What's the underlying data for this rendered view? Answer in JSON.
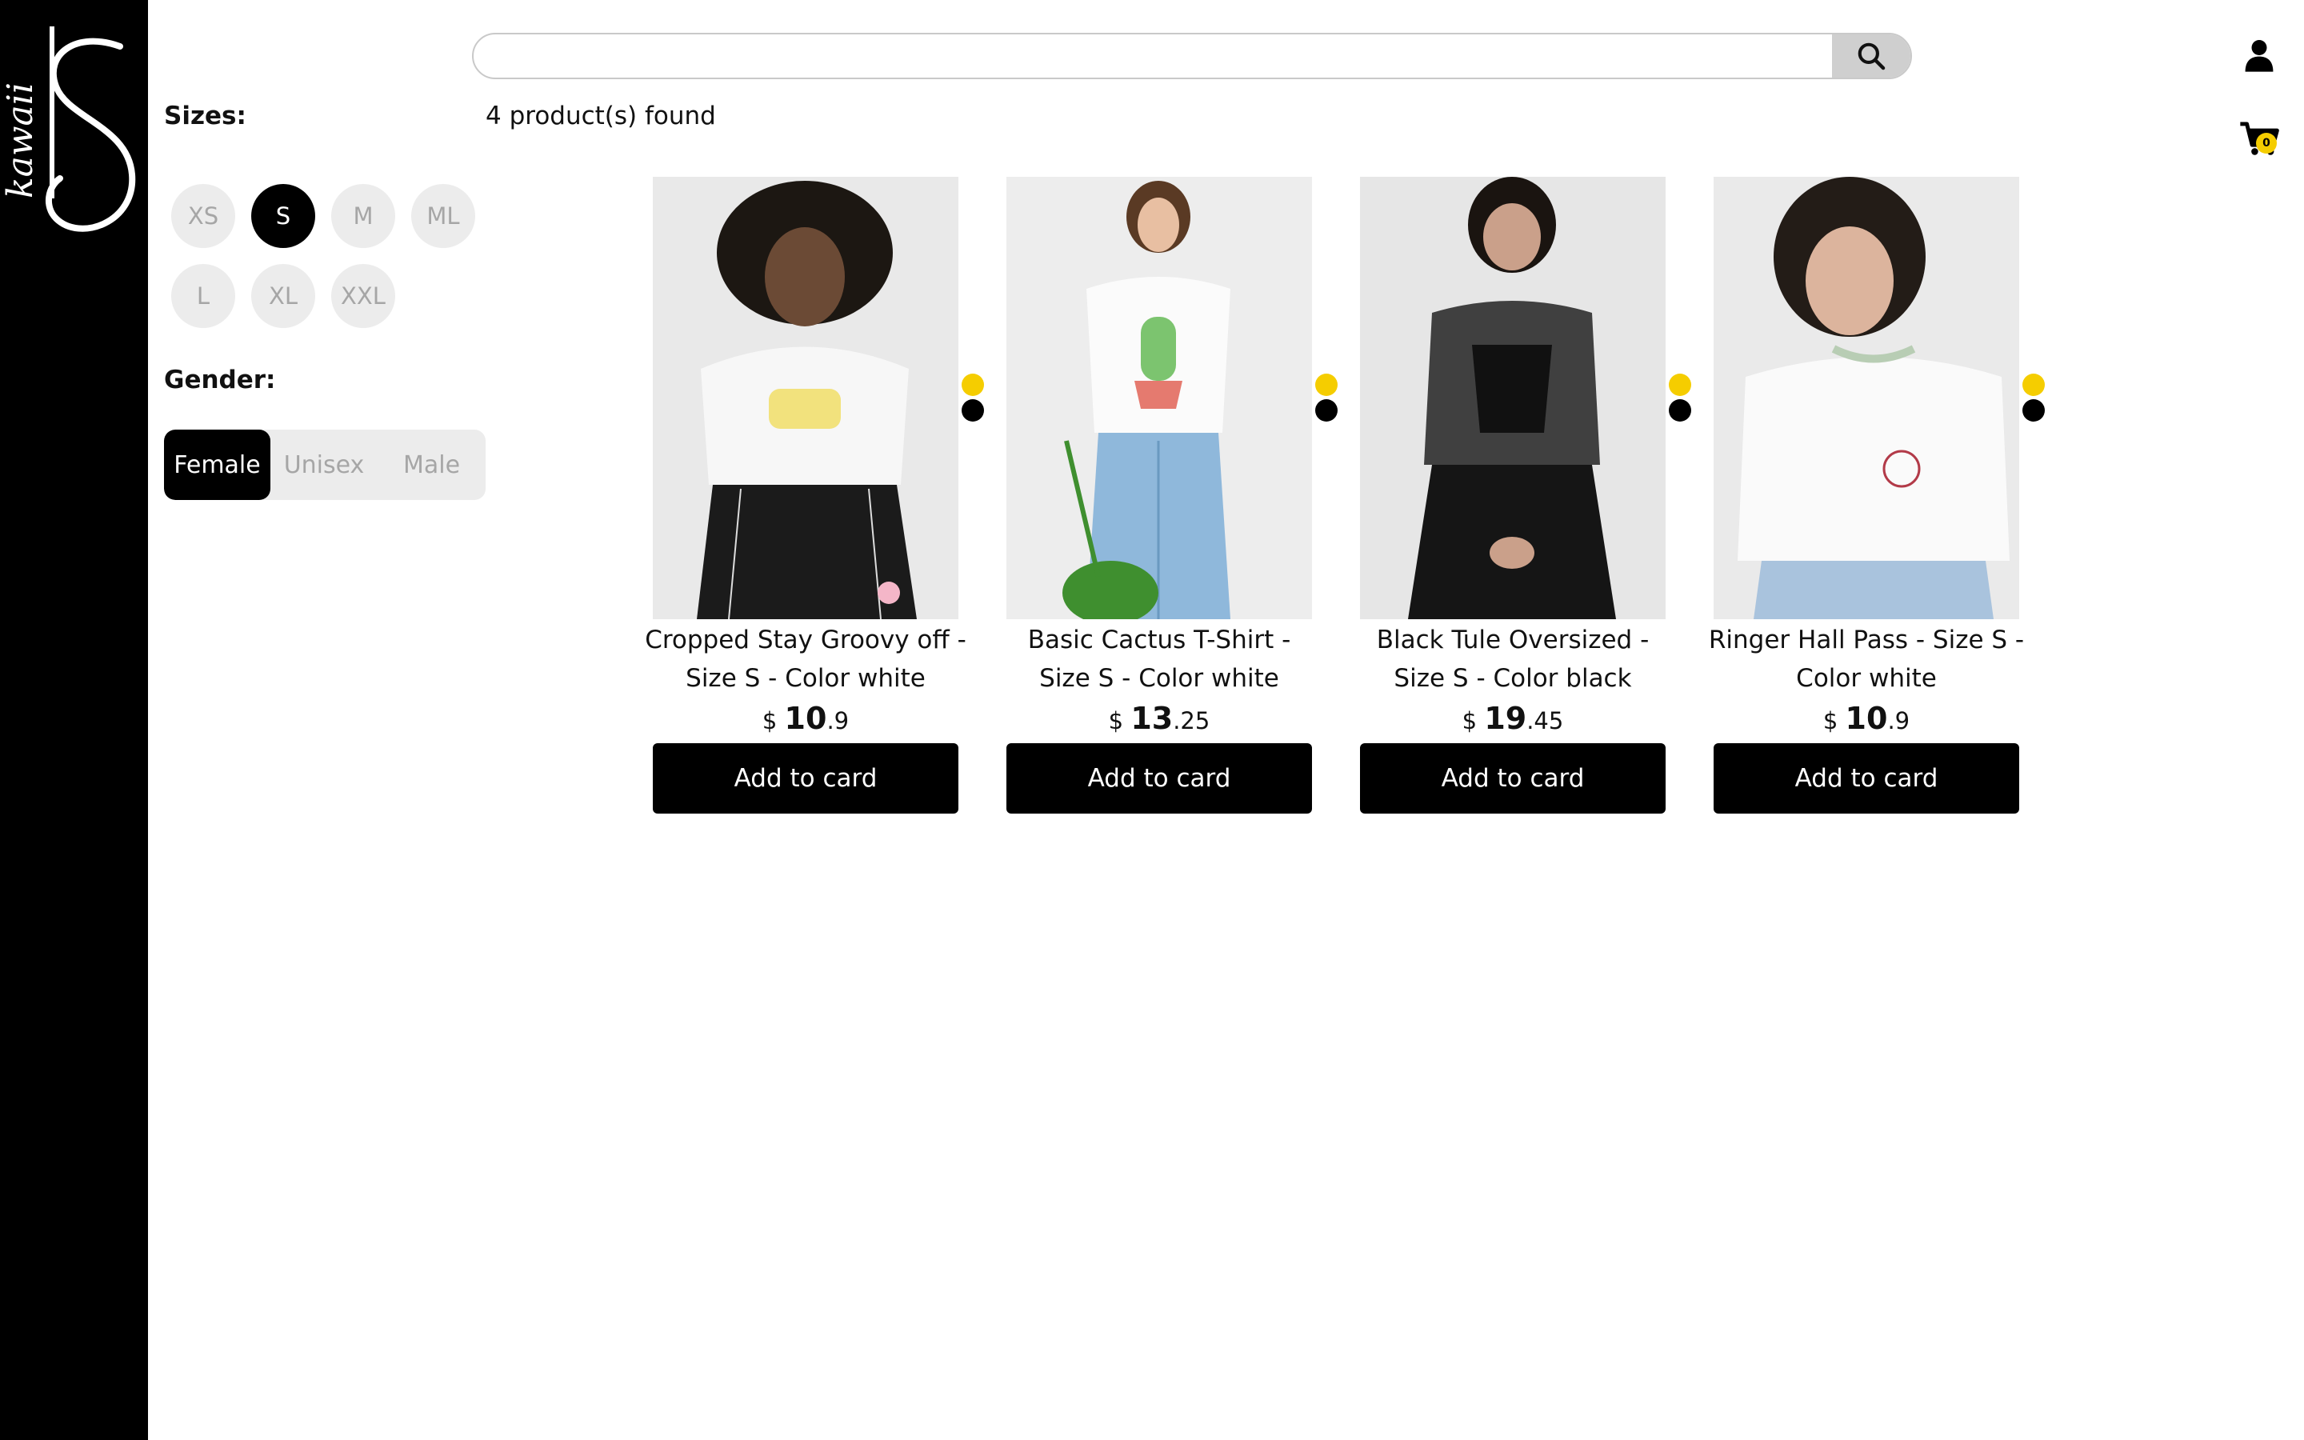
{
  "brand": {
    "logo_text": "kawaii"
  },
  "search": {
    "placeholder": "",
    "value": ""
  },
  "cart": {
    "count": "0"
  },
  "filters": {
    "sizes_label": "Sizes:",
    "sizes": [
      {
        "label": "XS",
        "active": false
      },
      {
        "label": "S",
        "active": true
      },
      {
        "label": "M",
        "active": false
      },
      {
        "label": "ML",
        "active": false
      },
      {
        "label": "L",
        "active": false
      },
      {
        "label": "XL",
        "active": false
      },
      {
        "label": "XXL",
        "active": false
      }
    ],
    "gender_label": "Gender:",
    "genders": [
      {
        "label": "Female",
        "active": true
      },
      {
        "label": "Unisex",
        "active": false
      },
      {
        "label": "Male",
        "active": false
      }
    ]
  },
  "results": {
    "count_text": "4 product(s) found"
  },
  "colors": {
    "swatch_yellow": "#f5cd00",
    "swatch_black": "#000000",
    "accent": "#000000"
  },
  "products": [
    {
      "title": "Cropped Stay Groovy off - Size S - Color white",
      "currency": "$",
      "price_int": "10",
      "price_dec": ".9",
      "button": "Add to card",
      "swatches": [
        "yellow",
        "black"
      ]
    },
    {
      "title": "Basic Cactus T-Shirt - Size S - Color white",
      "currency": "$",
      "price_int": "13",
      "price_dec": ".25",
      "button": "Add to card",
      "swatches": [
        "yellow",
        "black"
      ]
    },
    {
      "title": "Black Tule Oversized - Size S - Color black",
      "currency": "$",
      "price_int": "19",
      "price_dec": ".45",
      "button": "Add to card",
      "swatches": [
        "yellow",
        "black"
      ]
    },
    {
      "title": "Ringer Hall Pass - Size S - Color white",
      "currency": "$",
      "price_int": "10",
      "price_dec": ".9",
      "button": "Add to card",
      "swatches": [
        "yellow",
        "black"
      ]
    }
  ],
  "icons": {
    "search": "search-icon",
    "user": "user-icon",
    "cart": "cart-icon"
  }
}
